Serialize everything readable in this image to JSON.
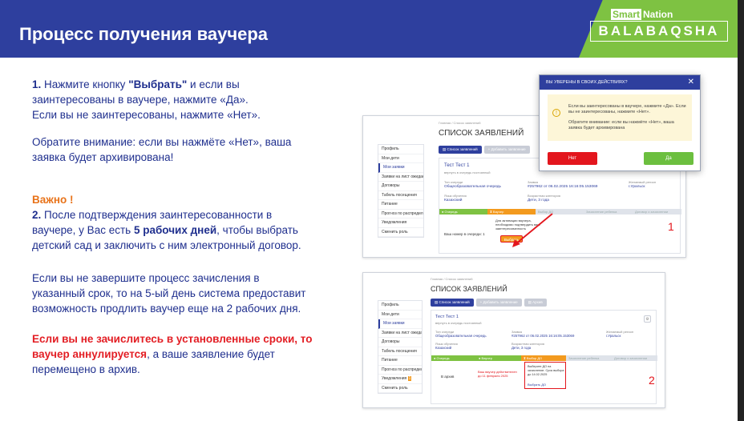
{
  "header": {
    "title": "Процесс получения ваучера",
    "brand_smart": "Smart",
    "brand_nation": "Nation",
    "brand_main": "BALABAQSHA"
  },
  "left": {
    "p1_num": "1.",
    "p1_a": "Нажмите кнопку",
    "p1_btn": "\"Выбрать\"",
    "p1_b": "и если вы",
    "p1_l2": "заинтересованы в ваучере, нажмите «Да».",
    "p1_l3": "Если вы не заинтересованы, нажмите «Нет».",
    "p2_l1": "Обратите внимание: если вы нажмёте «Нет», ваша",
    "p2_l2": "заявка будет архивирована!",
    "important": "Важно !",
    "p3_num": "2.",
    "p3_l1": "После подтверждения заинтересованности в",
    "p3_l2a": "ваучере, у Вас есть",
    "p3_l2b": "5 рабочих дней",
    "p3_l2c": ", чтобы выбрать",
    "p3_l3": "детский сад и заключить с ним электронный договор.",
    "p4_l1": "Если вы не завершите процесс зачисления в",
    "p4_l2": "указанный срок, то на 5-ый день система предоставит",
    "p4_l3": "возможность продлить ваучер еще на 2 рабочих дня.",
    "p5_l1": "Если вы не зачислитесь в установленные сроки, то",
    "p5_l2a": "ваучер аннулируется",
    "p5_l2b": ", а ваше заявление будет",
    "p5_l3": "перемещено в архив."
  },
  "shot1": {
    "breadcrumb": "Главная  /  Список заявлений",
    "title": "СПИСОК ЗАЯВЛЕНИЙ",
    "tab1": "Список заявлений",
    "tab2": "Добавить заявление",
    "sidebar": [
      "Профиль",
      "Мои дети",
      "Мои заявки",
      "Заявки на лист ожидания",
      "Договоры",
      "Табель посещения",
      "Питание",
      "Прогноз по распределению мест",
      "Уведомления",
      "Сменить роль"
    ],
    "child": "Тест Тест 1",
    "child_sub": "вернуть в очередь постоянный",
    "lbl_queue": "Тип очереди",
    "val_queue": "Общеобразовательная очередь",
    "lbl_app": "Заявка",
    "val_app": "#257962 от 06.02.2025 16:16:05.153069",
    "lbl_region": "Желаемый регион",
    "val_region": "г.Уральск",
    "lbl_lang": "Язык обучения",
    "val_lang": "Казахский",
    "lbl_age": "Возрастная категория",
    "val_age": "Дети, 3 года",
    "step1": "Очередь",
    "step2": "Ваучер",
    "step3": "Выбор ДО",
    "step4": "Зачисление ребенка",
    "step5": "Договор о зачислении",
    "queue_no": "Ваш номер в очереди: 1",
    "activation": "Для активации ваучера, необходимо подтвердить ваш заинтересованность",
    "btn_select": "Выбрать",
    "marker": "1"
  },
  "modal": {
    "title": "ВЫ УВЕРЕНЫ В СВОИХ ДЕЙСТВИЯХ?",
    "close": "✕",
    "text1": "Если вы заинтересованы в ваучере, нажмите «Да». Если вы не заинтересованы, нажмите «Нет».",
    "text2": "Обратите внимание: если вы нажмёте «Нет», ваша заявка будет архивирована",
    "no": "Нет",
    "yes": "Да"
  },
  "shot2": {
    "breadcrumb": "Главная  /  Список заявлений",
    "title": "СПИСОК ЗАЯВЛЕНИЙ",
    "tab1": "Список заявлений",
    "tab2": "Добавить заявление",
    "tab3": "Архив",
    "sidebar": [
      "Профиль",
      "Мои дети",
      "Мои заявки",
      "Заявки на лист ожидания",
      "Договоры",
      "Табель посещения",
      "Питание",
      "Прогноз по распределению мест",
      "Уведомления",
      "Сменить роль"
    ],
    "child": "Тест Тест 1",
    "child_sub": "вернуть в очередь постоянный",
    "lbl_queue": "Тип очереди",
    "val_queue": "Общеобразовательная очередь",
    "lbl_app": "Заявка",
    "val_app": "#257962 от 06.02.2025 16:16:05.153069",
    "lbl_region": "Желаемый регион",
    "val_region": "г.Уральск",
    "lbl_lang": "Язык обучения",
    "val_lang": "Казахский",
    "lbl_age": "Возрастная категория",
    "val_age": "Дети, 3 года",
    "step1": "Очередь",
    "step2": "Ваучер",
    "step3": "Выбор ДО",
    "step4": "Зачисление ребенка",
    "step5": "Договор о зачислении",
    "in_archive": "В архив",
    "voucher_valid": "Ваш ваучер действителен до 11 февраля 2025",
    "choose_do": "Выберите ДО на зачисление. Срок выбора до 14.02.2025",
    "choose_link": "Выбрать ДО",
    "notif_badge": "1",
    "marker": "2"
  }
}
